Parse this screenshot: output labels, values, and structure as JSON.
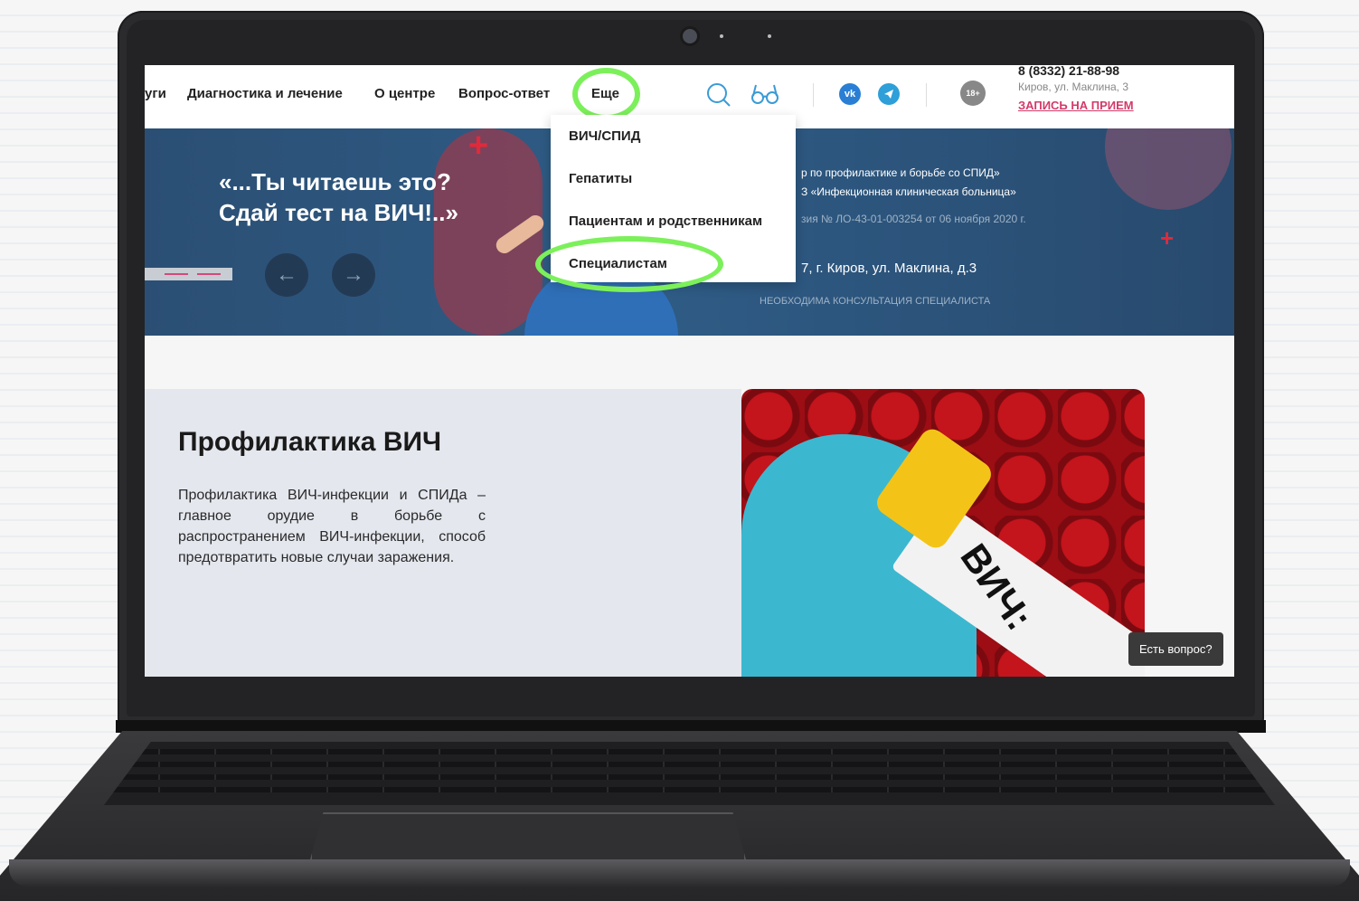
{
  "nav": {
    "items": [
      "уги",
      "Диагностика и лечение",
      "О центре",
      "Вопрос-ответ",
      "Еще"
    ],
    "age_badge": "18+",
    "social": [
      "vk-icon",
      "telegram-icon"
    ],
    "phone": "8 (8332) 21-88-98",
    "address": "Киров, ул. Маклина, 3",
    "appointment": "ЗАПИСЬ НА ПРИЕМ"
  },
  "dropdown": {
    "items": [
      "ВИЧ/СПИД",
      "Гепатиты",
      "Пациентам и родственникам",
      "Специалистам"
    ]
  },
  "banner": {
    "title_line1": "«...Ты читаешь это?",
    "title_line2": "Сдай тест на ВИЧ!..»",
    "info1": "р по профилактике и борьбе со СПИД»",
    "info2": "З «Инфекционная клиническая больница»",
    "info3": "зия № ЛО-43-01-003254 от 06 ноября 2020 г.",
    "info4": "7, г. Киров, ул. Маклина, д.3",
    "info5": "НЕОБХОДИМА КОНСУЛЬТАЦИЯ СПЕЦИАЛИСТА",
    "prev": "←",
    "next": "→"
  },
  "content": {
    "title": "Профилактика ВИЧ",
    "text": "Профилактика ВИЧ-инфекции и СПИДа – главное орудие в борьбе с распространением ВИЧ-инфекции, способ предотвратить новые случаи заражения.",
    "photo_label": "ВИЧ:"
  },
  "chat": {
    "label": "Есть вопрос?"
  },
  "colors": {
    "highlight": "#7cf05a",
    "accent": "#d33a6a",
    "banner": "#2f5c86"
  }
}
